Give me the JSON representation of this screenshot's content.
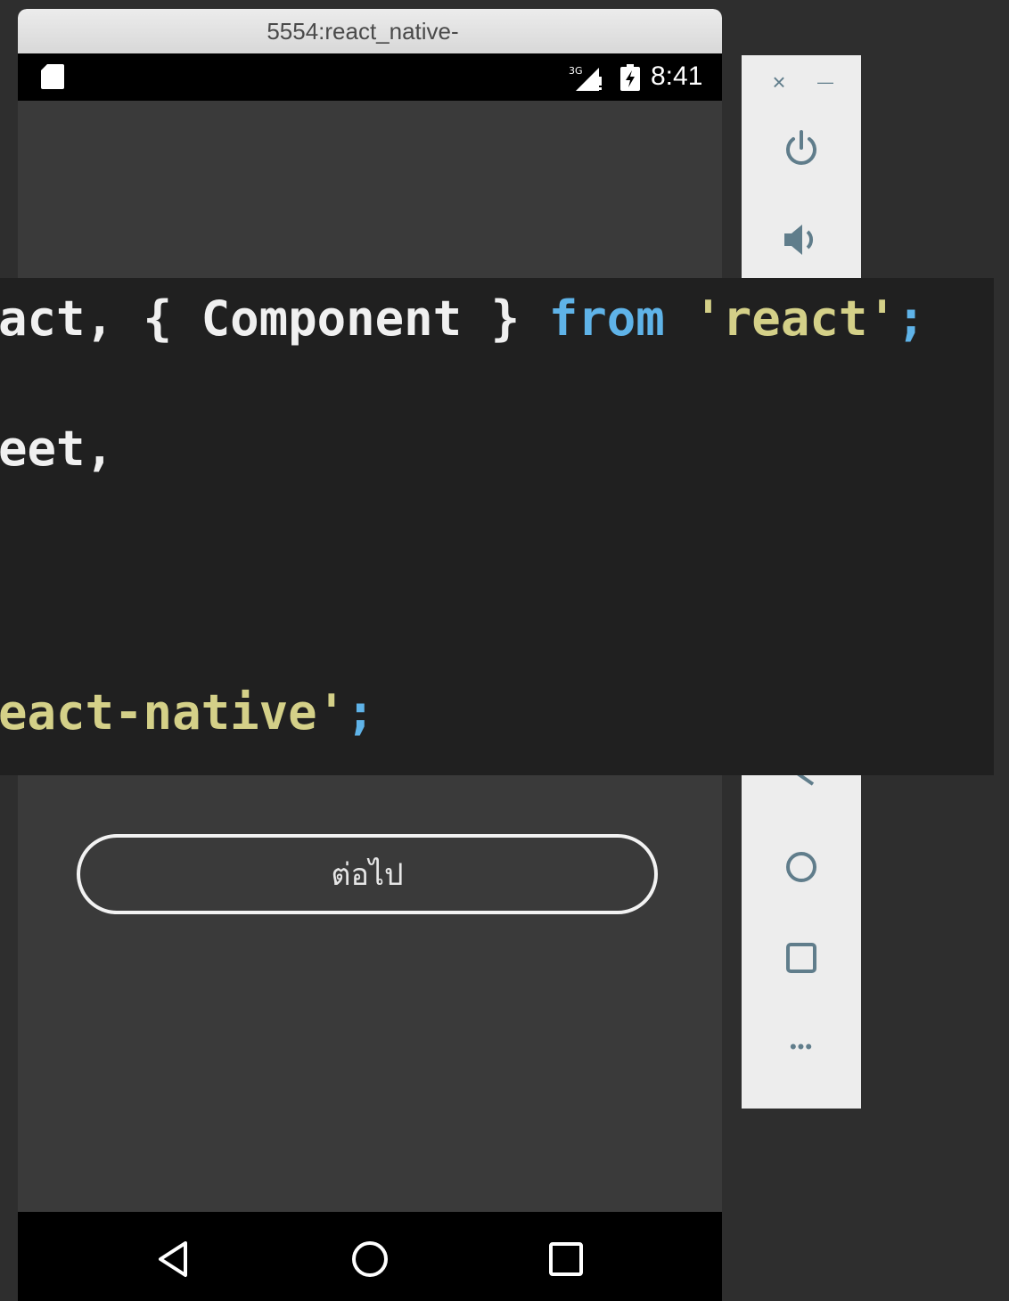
{
  "window": {
    "title": "5554:react_native-"
  },
  "statusbar": {
    "time": "8:41",
    "network": "3G"
  },
  "screen": {
    "button_label": "ต่อไป"
  },
  "side_panel": {
    "close": "×",
    "minimize": "—",
    "more": "•••"
  },
  "code": {
    "line1": {
      "part1": "act, { Component } ",
      "keyword": "from",
      "space": " ",
      "string": "'react'",
      "semi": ";"
    },
    "line2": "eet,",
    "line3": {
      "string": "eact-native'",
      "semi": ";"
    }
  },
  "colors": {
    "code_background": "#202020",
    "keyword": "#5fb3e8",
    "string": "#d4d088",
    "emulator_screen": "#3a3a3a"
  }
}
